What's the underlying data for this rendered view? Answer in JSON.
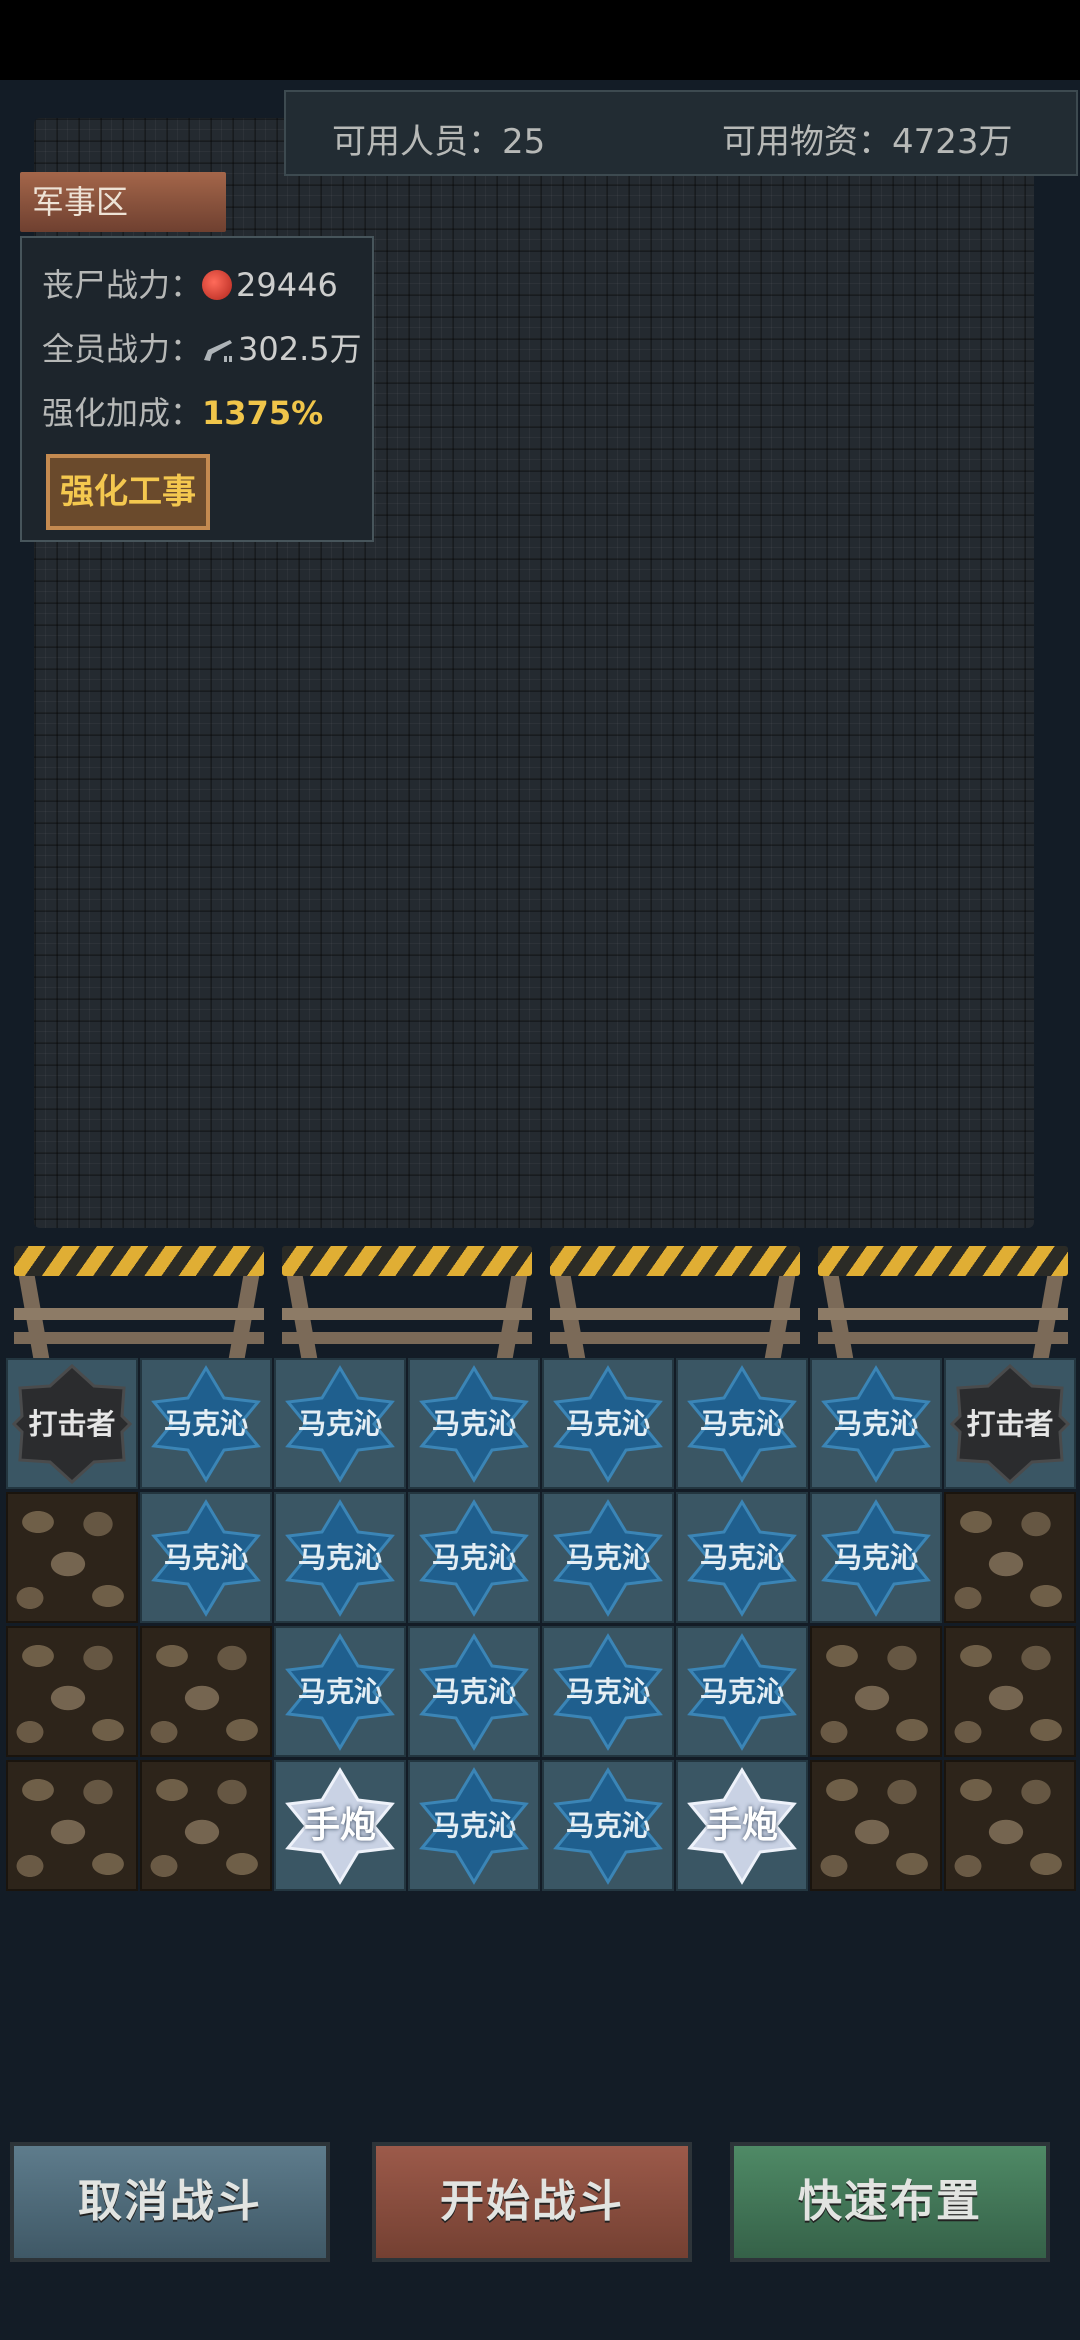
{
  "header": {
    "available_staff": "可用人员：25",
    "available_supplies": "可用物资：4723万"
  },
  "military": {
    "tab_label": "军事区",
    "zombie_power_label": "丧尸战力：",
    "zombie_power_icon": "blood-orb-icon",
    "zombie_power_value": "29446",
    "team_power_label": "全员战力：",
    "team_power_icon": "rifle-icon",
    "team_power_value": "302.5万",
    "boost_label": "强化加成：",
    "boost_value": "1375%",
    "fortify_button": "强化工事"
  },
  "grid": {
    "rows": [
      [
        "打击者",
        "马克沁",
        "马克沁",
        "马克沁",
        "马克沁",
        "马克沁",
        "马克沁",
        "打击者"
      ],
      [
        "",
        "马克沁",
        "马克沁",
        "马克沁",
        "马克沁",
        "马克沁",
        "马克沁",
        ""
      ],
      [
        "",
        "",
        "马克沁",
        "马克沁",
        "马克沁",
        "马克沁",
        "",
        ""
      ],
      [
        "",
        "",
        "手炮",
        "马克沁",
        "马克沁",
        "手炮",
        "",
        ""
      ]
    ]
  },
  "actions": {
    "cancel": "取消战斗",
    "start": "开始战斗",
    "quick": "快速布置"
  }
}
